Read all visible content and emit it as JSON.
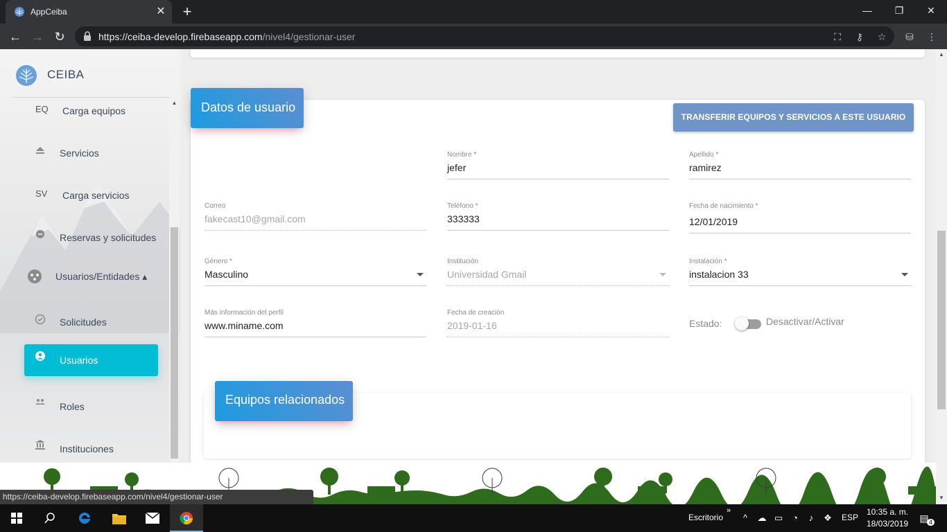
{
  "browser": {
    "tab_title": "AppCeiba",
    "url_host": "https://ceiba-develop.firebaseapp.com",
    "url_path": "/nivel4/gestionar-user",
    "status_url": "https://ceiba-develop.firebaseapp.com/nivel4/gestionar-user"
  },
  "sidebar": {
    "brand": "CEIBA",
    "items": [
      {
        "abbr": "EQ",
        "label": "Carga equipos"
      },
      {
        "icon": "eject-icon",
        "label": "Servicios"
      },
      {
        "abbr": "SV",
        "label": "Carga servicios"
      },
      {
        "icon": "reservation-icon",
        "label": "Reservas y solicitudes"
      },
      {
        "icon": "people-group-icon",
        "label": "Usuarios/Entidades ▴"
      },
      {
        "icon": "check-circle-icon",
        "label": "Solicitudes"
      },
      {
        "icon": "account-circle-icon",
        "label": "Usuarios",
        "active": true
      },
      {
        "icon": "roles-icon",
        "label": "Roles"
      },
      {
        "icon": "institution-icon",
        "label": "Instituciones"
      }
    ]
  },
  "form": {
    "header": "Datos de usuario",
    "transfer_button": "TRANSFERIR EQUIPOS Y SERVICIOS A ESTE USUARIO",
    "nombre": {
      "label": "Nombre *",
      "value": "jefer"
    },
    "apellido": {
      "label": "Apellido *",
      "value": "ramirez"
    },
    "correo": {
      "label": "Correo",
      "value": "fakecast10@gmail.com"
    },
    "telefono": {
      "label": "Teléfono *",
      "value": "333333"
    },
    "fecha_nacimiento": {
      "label": "Fecha de nacimiento *",
      "value": "12/01/2019"
    },
    "genero": {
      "label": "Género *",
      "value": "Masculino"
    },
    "institucion": {
      "label": "Institución",
      "value": "Universidad Gmail"
    },
    "instalacion": {
      "label": "Instalación *",
      "value": "instalacion 33"
    },
    "mas_info": {
      "label": "Más información del perfil",
      "value": "www.miname.com"
    },
    "fecha_creacion": {
      "label": "Fecha de creación",
      "value": "2019-01-16"
    },
    "estado_label": "Estado:",
    "toggle_label": "Desactivar/Activar",
    "estado_active": false
  },
  "related": {
    "header": "Equipos relacionados"
  },
  "taskbar": {
    "desktop_label": "Escritorio",
    "lang": "ESP",
    "time": "10:35 a. m.",
    "date": "18/03/2019",
    "notifications": "4"
  },
  "colors": {
    "accent_cyan": "#00bcd4",
    "header_blue": "#1e9be0",
    "button_blue": "#6f94c8"
  }
}
